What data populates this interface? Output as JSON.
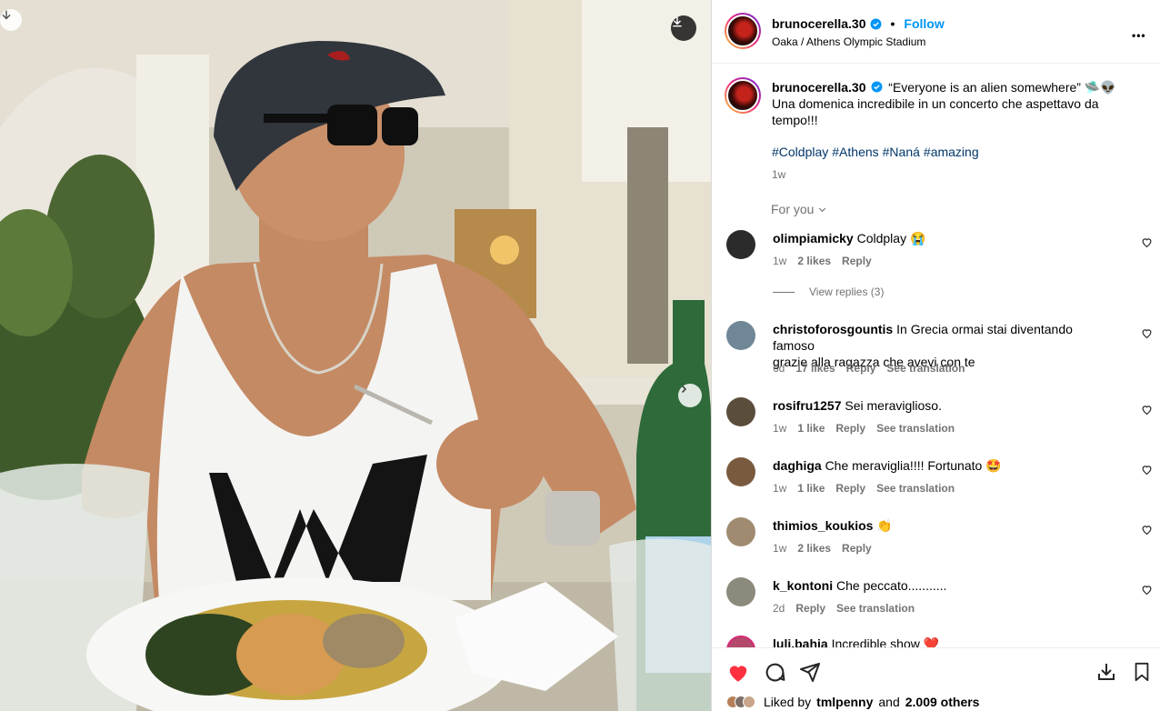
{
  "post": {
    "username": "brunocerella.30",
    "follow_label": "Follow",
    "location": "Oaka / Athens Olympic Stadium",
    "more_label": "•••",
    "caption_line1": "“Everyone is an alien somewhere” 🛸👽",
    "caption_line2": "Una domenica incredibile in un concerto che aspettavo da",
    "caption_line3": "tempo!!!",
    "hashtags": [
      "#Coldplay",
      "#Athens",
      "#Naná",
      "#amazing"
    ],
    "caption_time": "1w",
    "for_you_label": "For you"
  },
  "comments": [
    {
      "username": "olimpiamicky",
      "text": "Coldplay 😭",
      "time": "1w",
      "likes": "2 likes",
      "reply": "Reply",
      "translate": "",
      "avatar_color": "#2b2b2b"
    },
    {
      "username": "christoforosgountis",
      "text": "In Grecia ormai stai diventando famoso",
      "text2": "grazie alla ragazza che avevi con te",
      "time": "6d",
      "likes": "17 likes",
      "reply": "Reply",
      "translate": "See translation",
      "avatar_color": "#6f8796"
    },
    {
      "username": "rosifru1257",
      "text": "Sei meraviglioso.",
      "time": "1w",
      "likes": "1 like",
      "reply": "Reply",
      "translate": "See translation",
      "avatar_color": "#5b4d3c"
    },
    {
      "username": "daghiga",
      "text": "Che meraviglia!!!! Fortunato 🤩",
      "time": "1w",
      "likes": "1 like",
      "reply": "Reply",
      "translate": "See translation",
      "avatar_color": "#7a5a3e"
    },
    {
      "username": "thimios_koukios",
      "text": "👏",
      "time": "1w",
      "likes": "2 likes",
      "reply": "Reply",
      "translate": "",
      "avatar_color": "#a08b70"
    },
    {
      "username": "k_kontoni",
      "text": "Che peccato...........",
      "time": "2d",
      "likes": "",
      "reply": "Reply",
      "translate": "See translation",
      "avatar_color": "#8c8a7c"
    },
    {
      "username": "luli.bahia",
      "text": "Incredible show ❤️",
      "time": "",
      "likes": "",
      "reply": "",
      "translate": "",
      "avatar_color": "#b34a6b"
    }
  ],
  "view_replies_label": "View replies (3)",
  "likes_summary": {
    "prefix": "Liked by",
    "user": "tmlpenny",
    "middle": "and",
    "count": "2.009 others"
  },
  "colors": {
    "heart_liked": "#ff3040",
    "link_blue": "#0095f6",
    "hashtag": "#00376b",
    "muted": "#737373"
  }
}
